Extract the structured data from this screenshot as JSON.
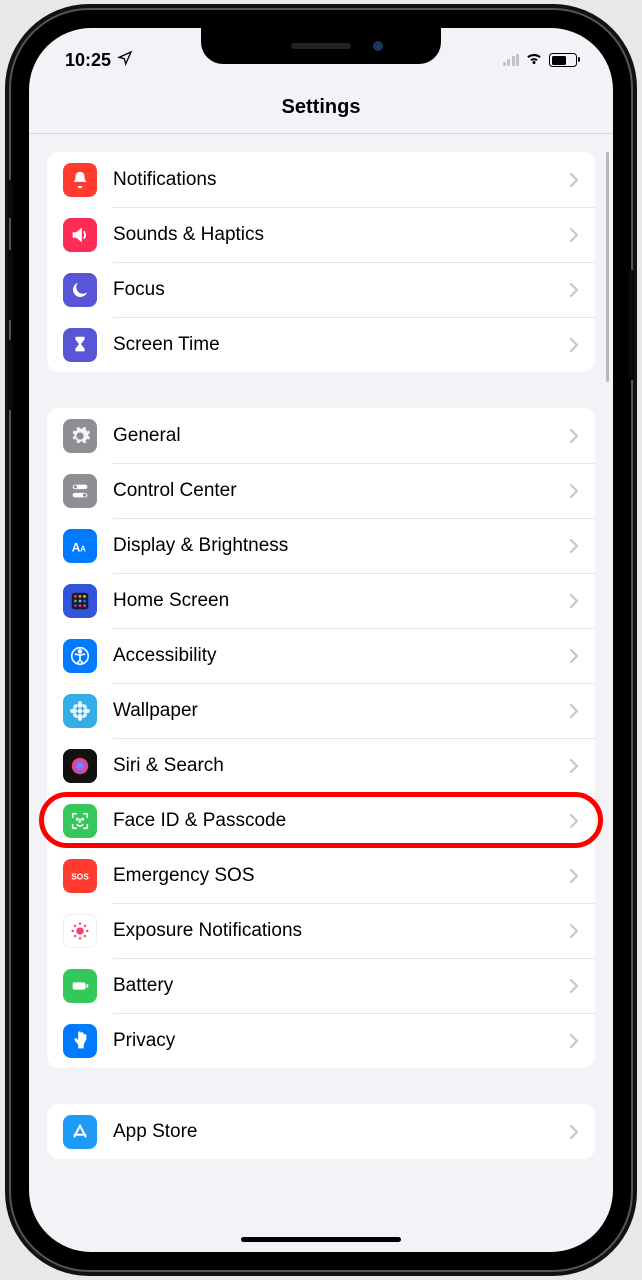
{
  "status": {
    "time": "10:25"
  },
  "header": {
    "title": "Settings"
  },
  "group1": [
    {
      "name": "notifications",
      "label": "Notifications",
      "bg": "#ff3b30",
      "icon": "bell"
    },
    {
      "name": "sounds-haptics",
      "label": "Sounds & Haptics",
      "bg": "#ff2d55",
      "icon": "speaker"
    },
    {
      "name": "focus",
      "label": "Focus",
      "bg": "#5856d6",
      "icon": "moon"
    },
    {
      "name": "screen-time",
      "label": "Screen Time",
      "bg": "#5856d6",
      "icon": "hourglass"
    }
  ],
  "group2": [
    {
      "name": "general",
      "label": "General",
      "bg": "#8e8e93",
      "icon": "gear"
    },
    {
      "name": "control-center",
      "label": "Control Center",
      "bg": "#8e8e93",
      "icon": "switches"
    },
    {
      "name": "display-brightness",
      "label": "Display & Brightness",
      "bg": "#007aff",
      "icon": "aa"
    },
    {
      "name": "home-screen",
      "label": "Home Screen",
      "bg": "#3355dd",
      "icon": "grid"
    },
    {
      "name": "accessibility",
      "label": "Accessibility",
      "bg": "#007aff",
      "icon": "access"
    },
    {
      "name": "wallpaper",
      "label": "Wallpaper",
      "bg": "#32ade6",
      "icon": "flower"
    },
    {
      "name": "siri-search",
      "label": "Siri & Search",
      "bg": "#111",
      "icon": "siri"
    },
    {
      "name": "face-id-passcode",
      "label": "Face ID & Passcode",
      "bg": "#34c759",
      "icon": "face",
      "highlighted": true
    },
    {
      "name": "emergency-sos",
      "label": "Emergency SOS",
      "bg": "#ff3b30",
      "icon": "sos"
    },
    {
      "name": "exposure-notifications",
      "label": "Exposure Notifications",
      "bg": "#fff",
      "icon": "exposure"
    },
    {
      "name": "battery",
      "label": "Battery",
      "bg": "#34c759",
      "icon": "battery"
    },
    {
      "name": "privacy",
      "label": "Privacy",
      "bg": "#007aff",
      "icon": "hand"
    }
  ],
  "group3": [
    {
      "name": "app-store",
      "label": "App Store",
      "bg": "#1d9bf6",
      "icon": "appstore"
    }
  ]
}
